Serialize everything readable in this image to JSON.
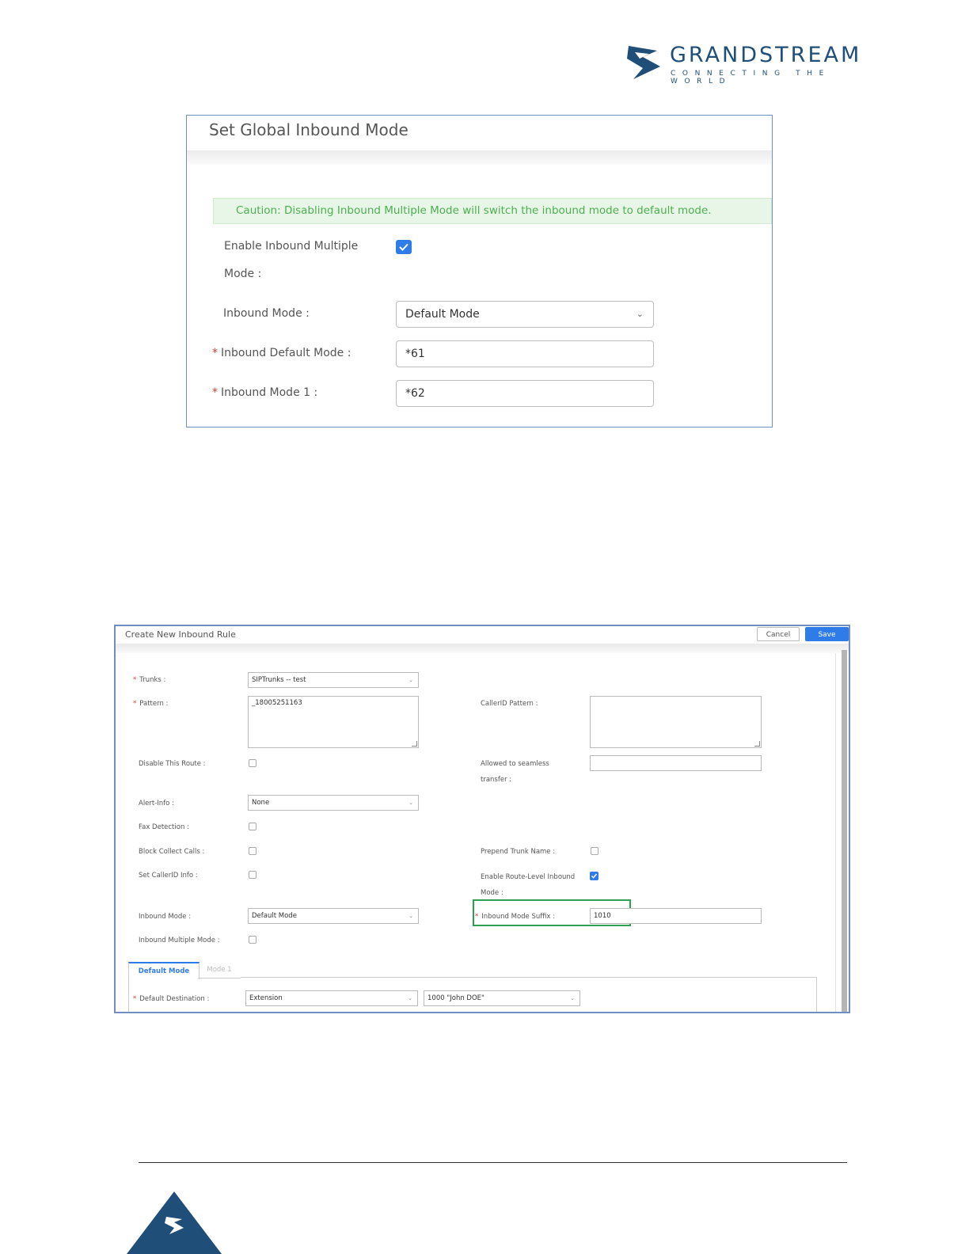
{
  "logo": {
    "brand": "GRANDSTREAM",
    "tagline": "CONNECTING THE WORLD"
  },
  "global_inbound": {
    "title": "Set Global Inbound Mode",
    "caution": "Caution: Disabling Inbound Multiple Mode will switch the inbound mode to default mode.",
    "enable_multiple_label_1": "Enable Inbound Multiple",
    "enable_multiple_label_2": "Mode :",
    "enable_multiple_checked": true,
    "inbound_mode_label": "Inbound Mode :",
    "inbound_mode_value": "Default Mode",
    "default_mode_label": "Inbound Default Mode :",
    "default_mode_value": "*61",
    "mode1_label": "Inbound Mode 1 :",
    "mode1_value": "*62"
  },
  "inbound_rule": {
    "title": "Create New Inbound Rule",
    "cancel_label": "Cancel",
    "save_label": "Save",
    "trunks_label": "Trunks :",
    "trunks_value": "SIPTrunks -- test",
    "pattern_label": "Pattern :",
    "pattern_value": "_18005251163",
    "callerid_pattern_label": "CallerID Pattern :",
    "callerid_pattern_value": "",
    "disable_route_label": "Disable This Route :",
    "seamless_label_1": "Allowed to seamless",
    "seamless_label_2": "transfer :",
    "alert_info_label": "Alert-Info :",
    "alert_info_value": "None",
    "fax_detection_label": "Fax Detection :",
    "block_collect_label": "Block Collect Calls :",
    "prepend_trunk_label": "Prepend Trunk Name :",
    "set_callerid_label": "Set CallerID Info :",
    "route_level_label_1": "Enable Route-Level Inbound",
    "route_level_label_2": "Mode :",
    "inbound_mode_label": "Inbound Mode :",
    "inbound_mode_value": "Default Mode",
    "suffix_label": "Inbound Mode Suffix :",
    "suffix_value": "1010",
    "inbound_multiple_label": "Inbound Multiple Mode :",
    "tab_default": "Default Mode",
    "tab_mode1": "Mode 1",
    "default_dest_label": "Default Destination :",
    "default_dest_type": "Extension",
    "default_dest_value": "1000 \"John DOE\""
  },
  "colors": {
    "accent": "#2f7be8",
    "brand": "#1f4e79",
    "caution_text": "#4caf50",
    "highlight": "#2e9e4f",
    "required": "#e53935"
  }
}
